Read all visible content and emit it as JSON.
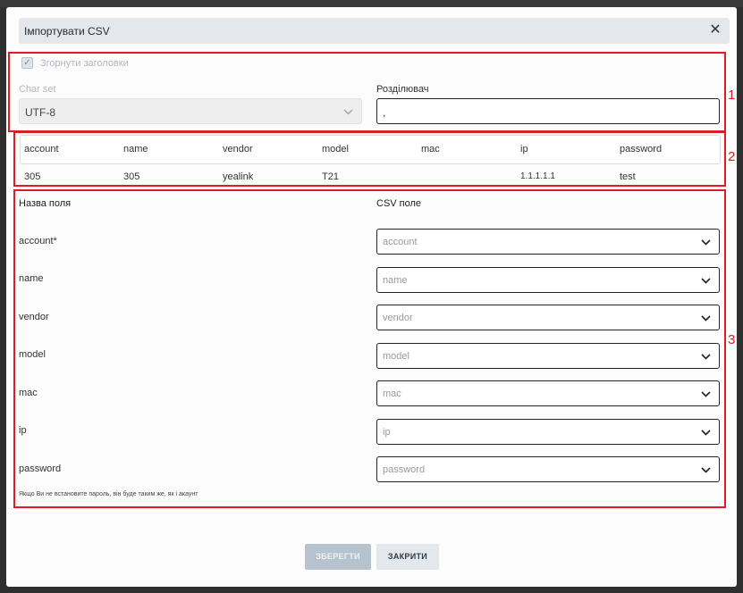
{
  "modal": {
    "title": "Імпортувати CSV",
    "close_icon": "close-icon"
  },
  "settings": {
    "collapse_headers_label": "Згорнути заголовки",
    "collapse_headers_checked": true,
    "charset_label": "Char set",
    "charset_value": "UTF-8",
    "delimiter_label": "Розділювач",
    "delimiter_value": ","
  },
  "preview": {
    "headers": [
      "account",
      "name",
      "vendor",
      "model",
      "mac",
      "ip",
      "password"
    ],
    "row": [
      "305",
      "305",
      "yealink",
      "T21",
      "",
      "1.1.1.1.1",
      "test"
    ]
  },
  "mapping": {
    "field_name_header": "Назва поля",
    "csv_field_header": "CSV поле",
    "rows": [
      {
        "label": "account*",
        "placeholder": "account"
      },
      {
        "label": "name",
        "placeholder": "name"
      },
      {
        "label": "vendor",
        "placeholder": "vendor"
      },
      {
        "label": "model",
        "placeholder": "model"
      },
      {
        "label": "mac",
        "placeholder": "mac"
      },
      {
        "label": "ip",
        "placeholder": "ip"
      },
      {
        "label": "password",
        "placeholder": "password"
      }
    ],
    "note": "Якщо Ви не встановите пароль, він буде таким же, як і акаунт"
  },
  "annotations": {
    "box1": "1",
    "box2": "2",
    "box3": "3",
    "color": "#e01b24"
  },
  "footer": {
    "save_label": "ЗБЕРЕГТИ",
    "close_label": "ЗАКРИТИ"
  }
}
